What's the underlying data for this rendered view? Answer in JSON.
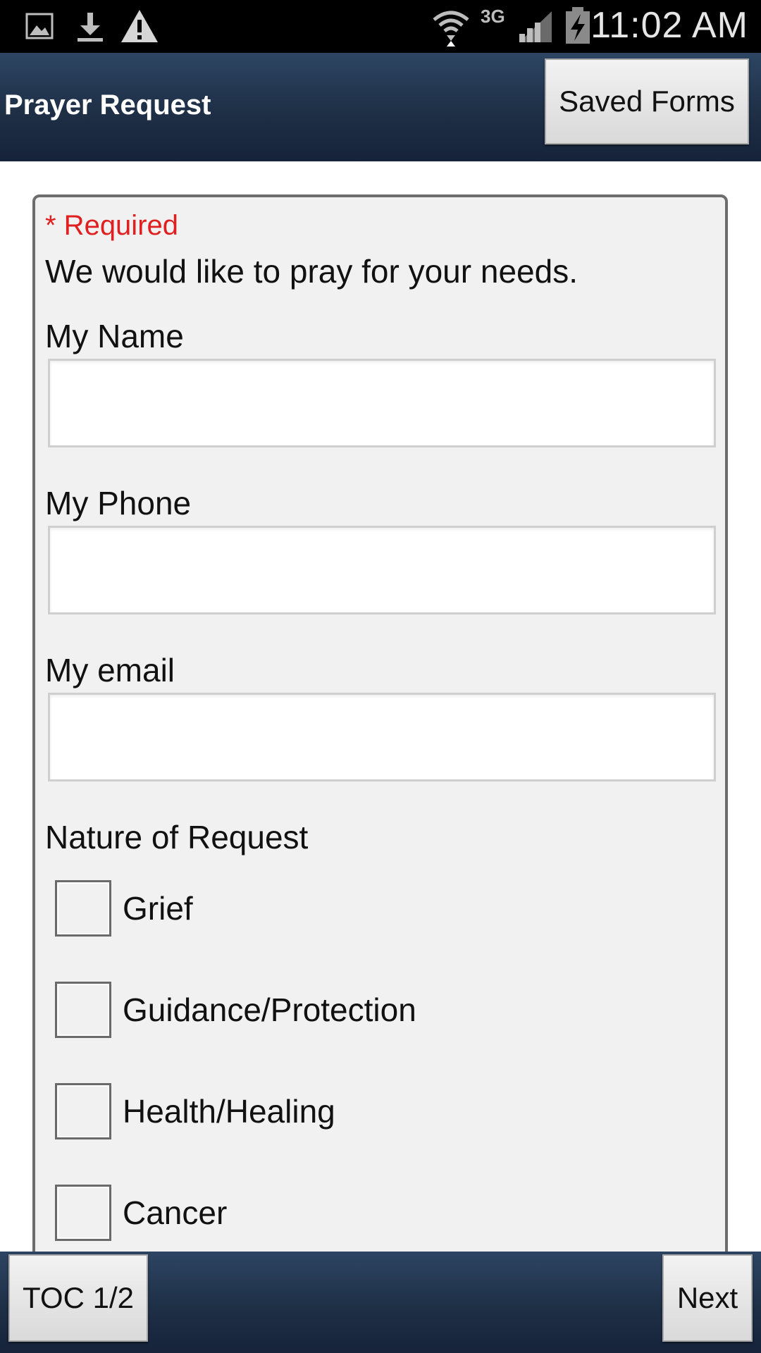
{
  "status_bar": {
    "time": "11:02 AM",
    "network": "3G",
    "icons": [
      "image-icon",
      "download-icon",
      "warning-icon",
      "wifi-icon",
      "signal-icon",
      "battery-charging-icon"
    ]
  },
  "header": {
    "title": "Prayer Request",
    "saved_forms_label": "Saved Forms"
  },
  "form": {
    "required_note": "* Required",
    "intro": "We would like to pray for your needs.",
    "fields": [
      {
        "label": "My Name",
        "value": ""
      },
      {
        "label": "My Phone",
        "value": ""
      },
      {
        "label": "My email",
        "value": ""
      }
    ],
    "request_label": "Nature of Request",
    "options": [
      {
        "label": "Grief",
        "checked": false
      },
      {
        "label": "Guidance/Protection",
        "checked": false
      },
      {
        "label": "Health/Healing",
        "checked": false
      },
      {
        "label": "Cancer",
        "checked": false
      }
    ]
  },
  "footer": {
    "toc_label": "TOC 1/2",
    "next_label": "Next"
  },
  "colors": {
    "bar": "#1e2f46",
    "required": "#e02020",
    "card": "#f1f1f1"
  }
}
